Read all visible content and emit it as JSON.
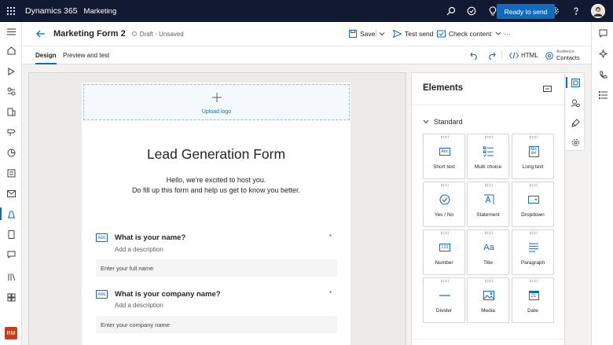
{
  "topbar": {
    "app_name": "Dynamics 365",
    "area_name": "Marketing"
  },
  "command_bar": {
    "form_title": "Marketing Form 2",
    "status": "Draft - Unsaved",
    "save_label": "Save",
    "test_send_label": "Test send",
    "check_content_label": "Check content",
    "more_label": "···",
    "primary_label": "Ready to send"
  },
  "tabs": [
    {
      "label": "Design"
    },
    {
      "label": "Preview and test"
    }
  ],
  "tab_bar_right": {
    "html_label": "HTML",
    "audience_caption": "Audience",
    "audience_value": "Contacts"
  },
  "user": {
    "initials": "RM"
  },
  "form": {
    "upload_logo": "Upload logo",
    "title": "Lead Generation Form",
    "subtitle_line1": "Hello, we're excited to host you.",
    "subtitle_line2": "Do fill up this form and help us get to know you better.",
    "questions": [
      {
        "icon_text": "Abc",
        "label": "What is your name?",
        "description": "Add a description",
        "required_mark": "*",
        "placeholder": "Enter your full name"
      },
      {
        "icon_text": "Abc",
        "label": "What is your company name?",
        "description": "Add a description",
        "required_mark": "*",
        "placeholder": "Enter your company name"
      }
    ]
  },
  "elements_panel": {
    "title": "Elements",
    "section": "Standard",
    "tiles": [
      {
        "label": "Short text",
        "icon": "short-text-icon",
        "icon_text": "Abc"
      },
      {
        "label": "Multi choice",
        "icon": "multi-choice-icon"
      },
      {
        "label": "Long text",
        "icon": "long-text-icon",
        "icon_text": "Abc def"
      },
      {
        "label": "Yes / No",
        "icon": "yes-no-icon"
      },
      {
        "label": "Statement",
        "icon": "statement-icon"
      },
      {
        "label": "Dropdown",
        "icon": "dropdown-icon"
      },
      {
        "label": "Number",
        "icon": "number-icon",
        "icon_text": "123"
      },
      {
        "label": "Title",
        "icon": "title-icon",
        "icon_text": "Aa"
      },
      {
        "label": "Paragraph",
        "icon": "paragraph-icon"
      },
      {
        "label": "Divider",
        "icon": "divider-icon"
      },
      {
        "label": "Media",
        "icon": "media-icon"
      },
      {
        "label": "Date",
        "icon": "date-icon",
        "icon_text": "21"
      }
    ]
  },
  "colors": {
    "accent": "#0f6cbd",
    "topbar": "#121a33",
    "required": "#c50f1f",
    "avatar_rm": "#c43e1c"
  }
}
